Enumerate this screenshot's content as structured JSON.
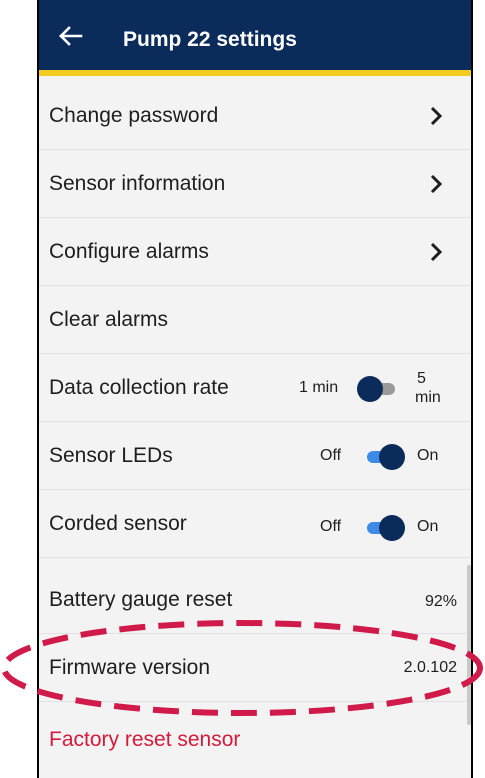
{
  "header": {
    "title": "Pump 22 settings",
    "back_icon": "arrow-left-icon",
    "bar_color": "#0b2c5a",
    "accent_color": "#f2cc1f"
  },
  "settings": {
    "change_password": "Change password",
    "sensor_information": "Sensor information",
    "configure_alarms": "Configure alarms",
    "clear_alarms": "Clear alarms",
    "data_collection_rate": {
      "label": "Data collection rate",
      "left_option": "1 min",
      "right_option_value": "5",
      "right_option_unit": "min",
      "state": "off"
    },
    "sensor_leds": {
      "label": "Sensor LEDs",
      "off_label": "Off",
      "on_label": "On",
      "state": "on"
    },
    "corded_sensor": {
      "label": "Corded sensor",
      "off_label": "Off",
      "on_label": "On",
      "state": "on"
    },
    "battery_gauge_reset": {
      "label": "Battery gauge reset",
      "value": "92%"
    },
    "firmware_version": {
      "label": "Firmware version",
      "value": "2.0.102"
    },
    "factory_reset": "Factory reset sensor"
  },
  "colors": {
    "danger": "#d41a3b",
    "toggle_on": "#3d8be6",
    "highlight": "#d01a4a"
  }
}
